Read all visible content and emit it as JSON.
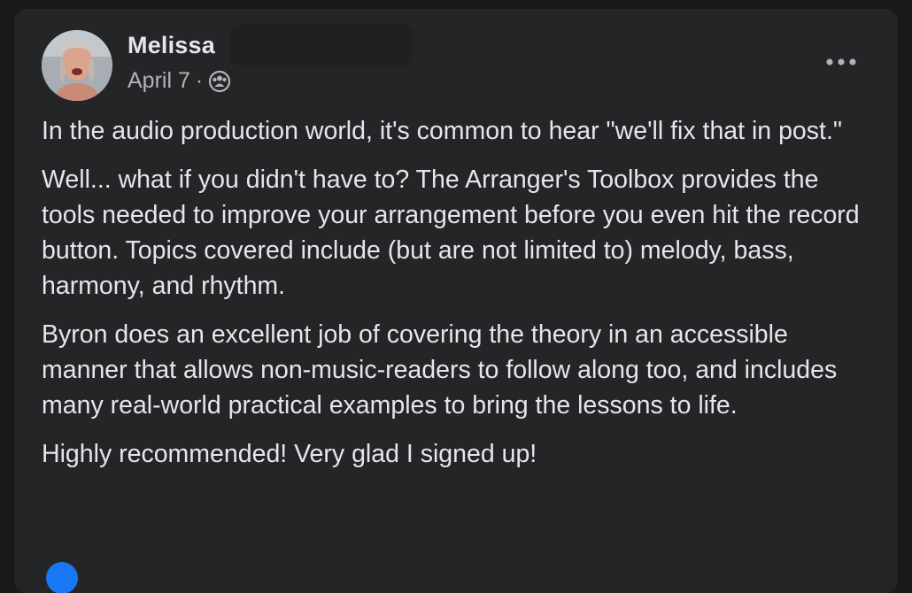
{
  "post": {
    "author_name": "Melissa",
    "date": "April 7",
    "separator": "·",
    "audience_icon": "group-icon",
    "more_icon": "more-horizontal-icon",
    "paragraphs": [
      "In the audio production world, it's common to hear \"we'll fix that in post.\"",
      "Well... what if you didn't have to?  The Arranger's Toolbox provides the tools needed to improve your arrangement before you even hit the record button.  Topics covered include (but are not limited to) melody, bass, harmony, and rhythm.",
      "Byron does an excellent job of covering the theory in an accessible manner that allows non-music-readers to follow along too, and includes many real-world practical examples to bring the lessons to life.",
      "Highly recommended!  Very glad I signed up!"
    ]
  },
  "colors": {
    "page_background": "#18191a",
    "card_background": "#242526",
    "primary_text": "#e4e6eb",
    "secondary_text": "#b0b3b8",
    "accent": "#1877f2"
  }
}
